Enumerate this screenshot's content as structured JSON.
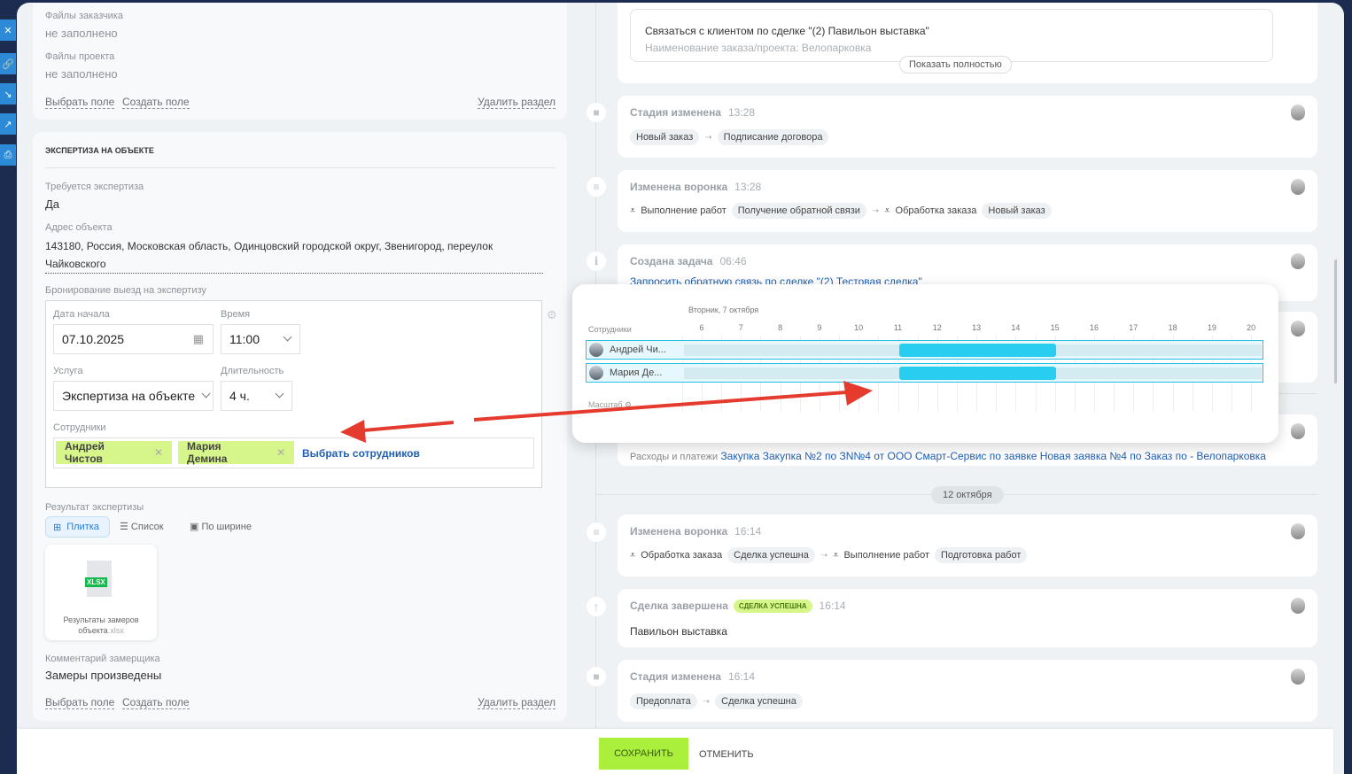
{
  "sidebar": {
    "icons": [
      "close-icon",
      "link-icon",
      "download-icon",
      "external-link-icon",
      "print-icon"
    ]
  },
  "left": {
    "card1": {
      "f1_label": "Файлы заказчика",
      "f1_value": "не заполнено",
      "f2_label": "Файлы проекта",
      "f2_value": "не заполнено",
      "select_field": "Выбрать поле",
      "create_field": "Создать поле",
      "delete_section": "Удалить раздел"
    },
    "card2": {
      "title": "ЭКСПЕРТИЗА НА ОБЪЕКТЕ",
      "need_label": "Требуется экспертиза",
      "need_value": "Да",
      "addr_label": "Адрес объекта",
      "addr_value": "143180, Россия, Московская область, Одинцовский городской округ, Звенигород, переулок Чайковского",
      "booking_label": "Бронирование выезд на экспертизу",
      "booking": {
        "date_label": "Дата начала",
        "date_value": "07.10.2025",
        "time_label": "Время",
        "time_value": "11:00",
        "service_label": "Услуга",
        "service_value": "Экспертиза на объекте",
        "duration_label": "Длительность",
        "duration_value": "4 ч.",
        "staff_label": "Сотрудники",
        "staff": [
          "Андрей Чистов",
          "Мария Демина"
        ],
        "choose_staff": "Выбрать сотрудников"
      },
      "result_label": "Результат экспертизы",
      "views": [
        "Плитка",
        "Список",
        "По ширине"
      ],
      "file_name": "Результаты замеров объекта",
      "file_ext": ".xlsx",
      "file_badge": "XLSX",
      "comment_label": "Комментарий замерщика",
      "comment_value": "Замеры произведены",
      "select_field": "Выбрать поле",
      "create_field": "Создать поле",
      "delete_section": "Удалить раздел"
    }
  },
  "popup": {
    "date": "Вторник, 7 октября",
    "staff_header": "Сотрудники",
    "hours": [
      "6",
      "7",
      "8",
      "9",
      "10",
      "11",
      "12",
      "13",
      "14",
      "15",
      "16",
      "17",
      "18",
      "19",
      "20"
    ],
    "rows": [
      {
        "name": "Андрей Чи...",
        "start": 11,
        "end": 15
      },
      {
        "name": "Мария Де...",
        "start": 11,
        "end": 15
      }
    ],
    "scale_label": "Масштаб",
    "bar_color": "#29cdf0"
  },
  "timeline": {
    "top_card": {
      "task": "Связаться с клиентом по сделке \"(2) Павильон выставка\"",
      "sub": "Наименование заказа/проекта: Велопарковка",
      "show_more": "Показать полностью"
    },
    "e1": {
      "title": "Стадия изменена",
      "time": "13:28",
      "from": "Новый заказ",
      "to": "Подписание договора"
    },
    "e2": {
      "title": "Изменена воронка",
      "time": "13:28",
      "f1": "Выполнение работ",
      "s1": "Получение обратной связи",
      "f2": "Обработка заказа",
      "s2": "Новый заказ"
    },
    "e3": {
      "title": "Создана задача",
      "time": "06:46",
      "link": "Запросить обратную связь по сделке \"(2) Тестовая сделка\""
    },
    "e5": {
      "prefix": "Расходы и платежи",
      "link": "Закупка Закупка №2 по ЗN№4 от ООО Смарт-Сервис по заявке Новая заявка №4 по Заказ по - Велопарковка"
    },
    "date_sep": "12 октября",
    "e6": {
      "title": "Изменена воронка",
      "time": "16:14",
      "f1": "Обработка заказа",
      "s1": "Сделка успешна",
      "f2": "Выполнение работ",
      "s2": "Подготовка работ"
    },
    "e7": {
      "title": "Сделка завершена",
      "badge": "СДЕЛКА УСПЕШНА",
      "time": "16:14",
      "text": "Павильон выставка"
    },
    "e8": {
      "title": "Стадия изменена",
      "time": "16:14",
      "from": "Предоплата",
      "to": "Сделка успешна"
    }
  },
  "footer": {
    "save": "СОХРАНИТЬ",
    "cancel": "ОТМЕНИТЬ"
  }
}
